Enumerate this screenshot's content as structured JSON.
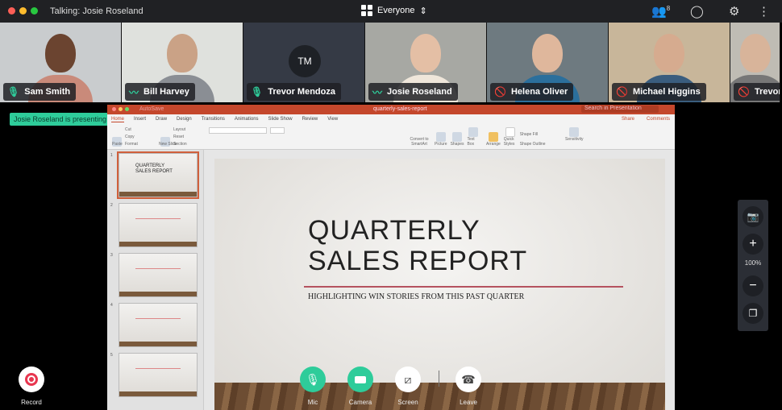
{
  "topbar": {
    "talking": "Talking: Josie Roseland",
    "audience": "Everyone",
    "participant_count": "8"
  },
  "participants": [
    {
      "name": "Sam Smith",
      "mic": "active",
      "skin": "#6b4430",
      "shirt": "#c98a7a",
      "bg": "#c9ccce"
    },
    {
      "name": "Bill Harvey",
      "mic": "speaking",
      "skin": "#caa286",
      "shirt": "#8a8e94",
      "bg": "#dfe1dd"
    },
    {
      "name": "Trevor Mendoza",
      "initials": "TM",
      "mic": "active",
      "bg": "#353a45"
    },
    {
      "name": "Josie Roseland",
      "mic": "speaking",
      "skin": "#e4bfa5",
      "shirt": "#efe6da",
      "bg": "#a7a8a3"
    },
    {
      "name": "Helena Oliver",
      "mic": "muted",
      "skin": "#dfb79c",
      "shirt": "#2b6f9c",
      "bg": "#6e7a80"
    },
    {
      "name": "Michael Higgins",
      "mic": "muted",
      "skin": "#d6ab8f",
      "shirt": "#3a5d7e",
      "bg": "#c8b69a"
    },
    {
      "name": "Trevor",
      "mic": "muted",
      "skin": "#d8b49a",
      "shirt": "#777",
      "bg": "#bfbcb4"
    }
  ],
  "presenting_badge": "Josie Roseland is presenting",
  "ppt": {
    "autosave": "AutoSave",
    "filename": "quarterly-sales-report",
    "search_placeholder": "Search in Presentation",
    "tabs": [
      "Home",
      "Insert",
      "Draw",
      "Design",
      "Transitions",
      "Animations",
      "Slide Show",
      "Review",
      "View"
    ],
    "share": "Share",
    "comments": "Comments",
    "ribbon": {
      "paste": "Paste",
      "cut": "Cut",
      "copy": "Copy",
      "format": "Format",
      "new_slide": "New Slide",
      "layout": "Layout",
      "reset": "Reset",
      "section": "Section",
      "convert": "Convert to SmartArt",
      "picture": "Picture",
      "shapes": "Shapes",
      "textbox": "Text Box",
      "arrange": "Arrange",
      "quick_styles": "Quick Styles",
      "shape_fill": "Shape Fill",
      "shape_outline": "Shape Outline",
      "sensitivity": "Sensitivity"
    },
    "thumbnails": [
      {
        "num": "1",
        "title": "QUARTERLY SALES REPORT"
      },
      {
        "num": "2"
      },
      {
        "num": "3"
      },
      {
        "num": "4"
      },
      {
        "num": "5"
      }
    ],
    "slide": {
      "title_line1": "QUARTERLY",
      "title_line2": "SALES REPORT",
      "subtitle": "HIGHLIGHTING WIN STORIES FROM THIS PAST QUARTER"
    }
  },
  "zoom": {
    "level": "100%"
  },
  "controls": {
    "record": "Record",
    "mic": "Mic",
    "camera": "Camera",
    "screen": "Screen",
    "leave": "Leave"
  },
  "colors": {
    "accent_green": "#2ecc9a",
    "ppt_orange": "#c4472c",
    "muted_red": "#e0344a",
    "record_red": "#e8364f"
  }
}
